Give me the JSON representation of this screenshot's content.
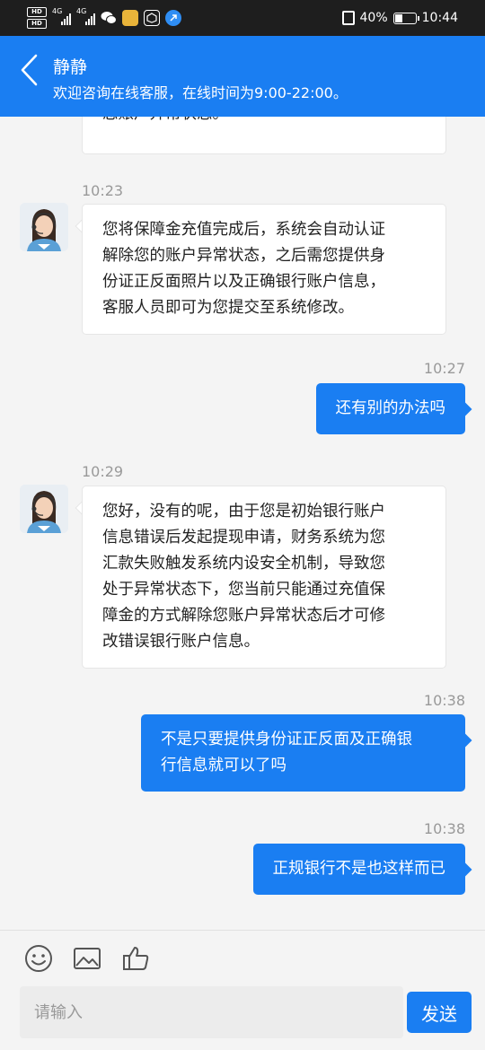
{
  "status_bar": {
    "network_1": "4G",
    "network_2": "4G",
    "battery": "40%",
    "battery_level": 0.4,
    "time": "10:44"
  },
  "header": {
    "title": "静静",
    "subtitle": "欢迎咨询在线客服，在线时间为9:00-22:00。"
  },
  "messages": [
    {
      "side": "in",
      "time": "",
      "text": "您账户异常状态。"
    },
    {
      "side": "in",
      "time": "10:23",
      "lines": [
        "您将保障金充值完成后，系统会自动认证",
        "解除您的账户异常状态，之后需您提供身",
        "份证正反面照片以及正确银行账户信息，",
        "客服人员即可为您提交至系统修改。"
      ]
    },
    {
      "side": "out",
      "time": "10:27",
      "text": "还有别的办法吗"
    },
    {
      "side": "in",
      "time": "10:29",
      "lines": [
        "您好，没有的呢，由于您是初始银行账户",
        "信息错误后发起提现申请，财务系统为您",
        "汇款失败触发系统内设安全机制，导致您",
        "处于异常状态下，您当前只能通过充值保",
        "障金的方式解除您账户异常状态后才可修",
        "改错误银行账户信息。"
      ]
    },
    {
      "side": "out",
      "time": "10:38",
      "lines": [
        "不是只要提供身份证正反面及正确银",
        "行信息就可以了吗"
      ]
    },
    {
      "side": "out",
      "time": "10:38",
      "text": "正规银行不是也这样而已"
    }
  ],
  "input": {
    "placeholder": "请输入",
    "send_label": "发送"
  },
  "toolbar": {
    "icons": [
      "emoji-icon",
      "image-icon",
      "thumbs-up-icon"
    ]
  },
  "colors": {
    "accent": "#1a7ef2",
    "background": "#f4f4f4",
    "status_bar": "#1e1e1e"
  }
}
